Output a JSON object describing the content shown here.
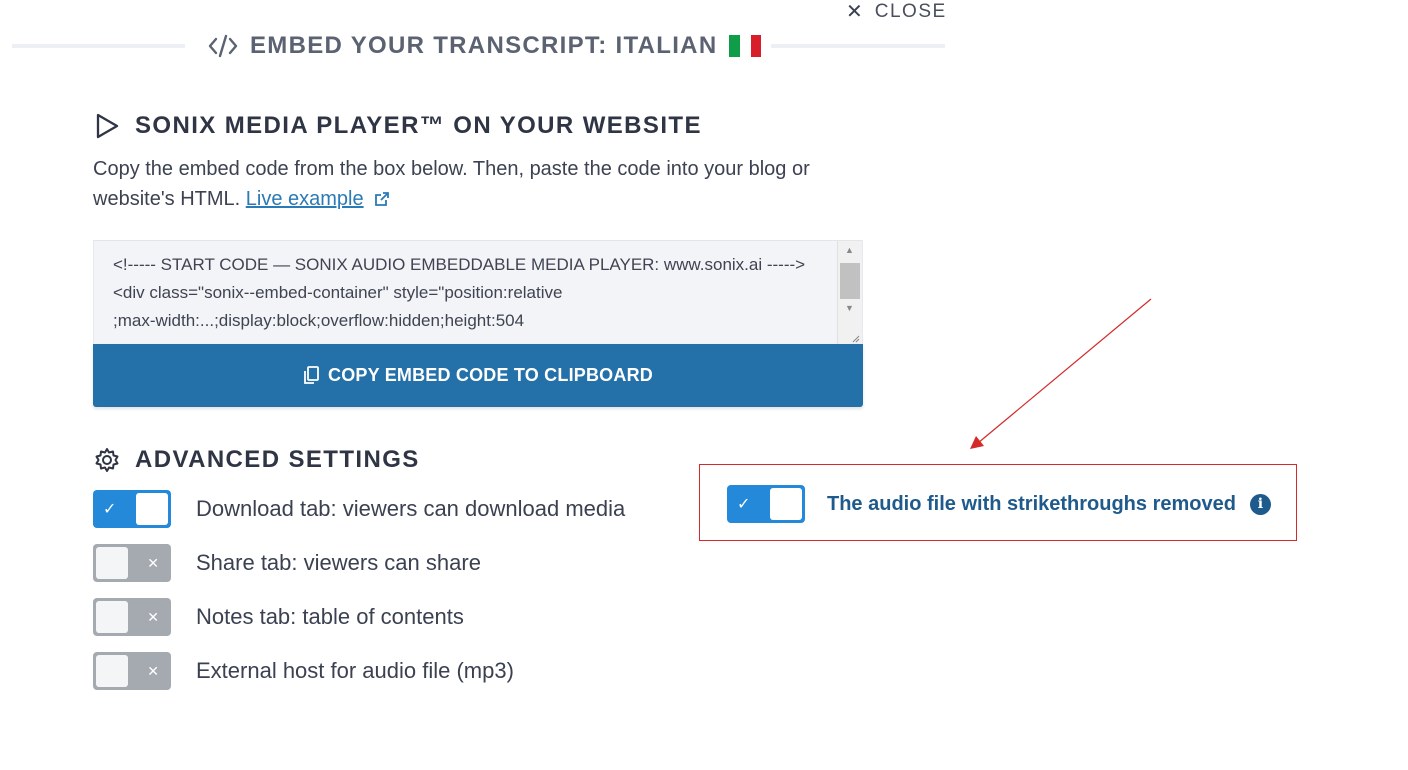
{
  "close": {
    "label": "CLOSE",
    "icon": "close-icon"
  },
  "header": {
    "title": "EMBED YOUR TRANSCRIPT: ITALIAN",
    "icon": "code-icon",
    "flag_colors": [
      "#109d49",
      "#ffffff",
      "#d81e2a"
    ]
  },
  "player_section": {
    "title": "SONIX MEDIA PLAYER™ ON YOUR WEBSITE",
    "icon": "play-icon",
    "description": "Copy the embed code from the box below. Then, paste the code into your blog or website's HTML.",
    "link_label": "Live example",
    "embed_code": "<!----- START CODE — SONIX AUDIO EMBEDDABLE MEDIA PLAYER: www.sonix.ai ----->\n<div class=\"sonix--embed-container\" style=\"position:relative\n;max-width:...;display:block;overflow:hidden;height:504",
    "copy_button_label": "COPY EMBED CODE TO CLIPBOARD",
    "accent_color": "#2470a8"
  },
  "advanced": {
    "title": "ADVANCED SETTINGS",
    "icon": "gear-icon",
    "settings": [
      {
        "label": "Download tab: viewers can download media",
        "enabled": true
      },
      {
        "label": "Share tab: viewers can share",
        "enabled": false
      },
      {
        "label": "Notes tab: table of contents",
        "enabled": false
      },
      {
        "label": "External host for audio file (mp3)",
        "enabled": false
      }
    ]
  },
  "annotation": {
    "label": "The audio file with strikethroughs removed",
    "enabled": true,
    "icon": "info-icon",
    "color": "#d42a2a"
  }
}
